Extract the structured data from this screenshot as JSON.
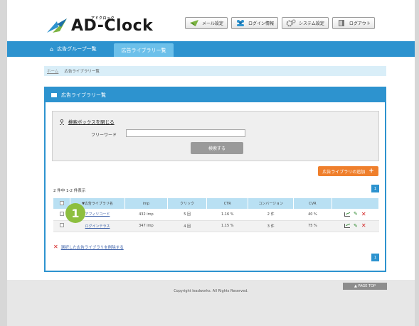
{
  "header": {
    "logo_sub": "アドクロック",
    "logo_text": "AD-Clock",
    "buttons": [
      {
        "label": "メール設定",
        "icon": "envelope-icon"
      },
      {
        "label": "ログイン情報",
        "icon": "users-icon"
      },
      {
        "label": "システム設定",
        "icon": "gears-icon"
      },
      {
        "label": "ログアウト",
        "icon": "door-icon"
      }
    ]
  },
  "nav": {
    "items": [
      {
        "label": "広告グループ一覧",
        "icon": "home-icon"
      },
      {
        "label": "広告ライブラリー覧",
        "active": true
      }
    ]
  },
  "breadcrumb": {
    "home": "ホーム",
    "current": "広告ライブラリー覧"
  },
  "panel": {
    "title": "広告ライブラリー覧",
    "search_toggle": "検索ボックスを閉じる",
    "freeword_label": "フリーワード",
    "freeword_value": "",
    "search_button": "検索する",
    "add_button": "広告ライブラリの追加",
    "count_text": "2 件中 1-2 件表示",
    "page_number": "1",
    "columns": [
      "",
      "▼広告ライブラリ名",
      "imp",
      "クリック",
      "CTR",
      "コンバージョン",
      "CVR",
      ""
    ],
    "rows": [
      {
        "name": "アフィリコード",
        "imp": "432 imp",
        "click": "5 回",
        "ctr": "1.16 %",
        "cv": "2 件",
        "cvr": "40 %"
      },
      {
        "name": "ログインテラス",
        "imp": "347 imp",
        "click": "4 回",
        "ctr": "1.15 %",
        "cv": "3 件",
        "cvr": "75 %"
      }
    ],
    "delete_selected": "選択した広告ライブラリを削除する",
    "badge": "1"
  },
  "footer": {
    "copyright": "Copyright leadworks. All Rights Reserved.",
    "pagetop": "▲ PAGE TOP"
  },
  "colors": {
    "accent": "#2d93cf",
    "orange": "#ef7f2c",
    "badge": "#8dbf3f",
    "delete": "#d42020"
  }
}
